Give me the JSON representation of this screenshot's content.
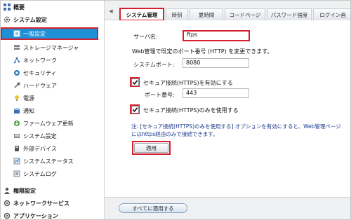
{
  "sidebar": {
    "top_items": [
      {
        "label": "概要"
      },
      {
        "label": "システム設定"
      }
    ],
    "items": [
      {
        "label": "一般設定"
      },
      {
        "label": "ストレージマネージャ"
      },
      {
        "label": "ネットワーク"
      },
      {
        "label": "セキュリティ"
      },
      {
        "label": "ハードウェア"
      },
      {
        "label": "電源"
      },
      {
        "label": "通知"
      },
      {
        "label": "ファームウェア更新"
      },
      {
        "label": "システム設定"
      },
      {
        "label": "外部デバイス"
      },
      {
        "label": "システムステータス"
      },
      {
        "label": "システムログ"
      }
    ],
    "bottom_items": [
      {
        "label": "権限設定"
      },
      {
        "label": "ネットワークサービス"
      },
      {
        "label": "アプリケーション"
      }
    ]
  },
  "tabs": [
    {
      "label": "システム管理"
    },
    {
      "label": "時刻"
    },
    {
      "label": "夏時間"
    },
    {
      "label": "コードページ"
    },
    {
      "label": "パスワード強度"
    },
    {
      "label": "ログイン画"
    }
  ],
  "form": {
    "server_name_label": "サーバ名:",
    "server_name_value": "ftps",
    "port_hint": "Web管理で既定のポート番号 (HTTP) を変更できます。",
    "system_port_label": "システムポート:",
    "system_port_value": "8080",
    "https_enable_label": "セキュア接続(HTTPS)を有効にする",
    "https_enable_checked": true,
    "port_number_label": "ポート番号:",
    "port_number_value": "443",
    "https_only_label": "セキュア接続(HTTPS)のみを使用する",
    "https_only_checked": true,
    "note_line1": "注: [セキュア接続(HTTPS)のみを使用する] オプションを有効にすると、Web管理ページ",
    "note_line2": "にはhttps経由のみで接続できます。",
    "apply_label": "適用"
  },
  "footer": {
    "apply_all_label": "すべてに適用する"
  },
  "colors": {
    "highlight_frame": "#d42030",
    "active_item_bg": "#1e90d6",
    "note_text": "#1a3a8a"
  }
}
